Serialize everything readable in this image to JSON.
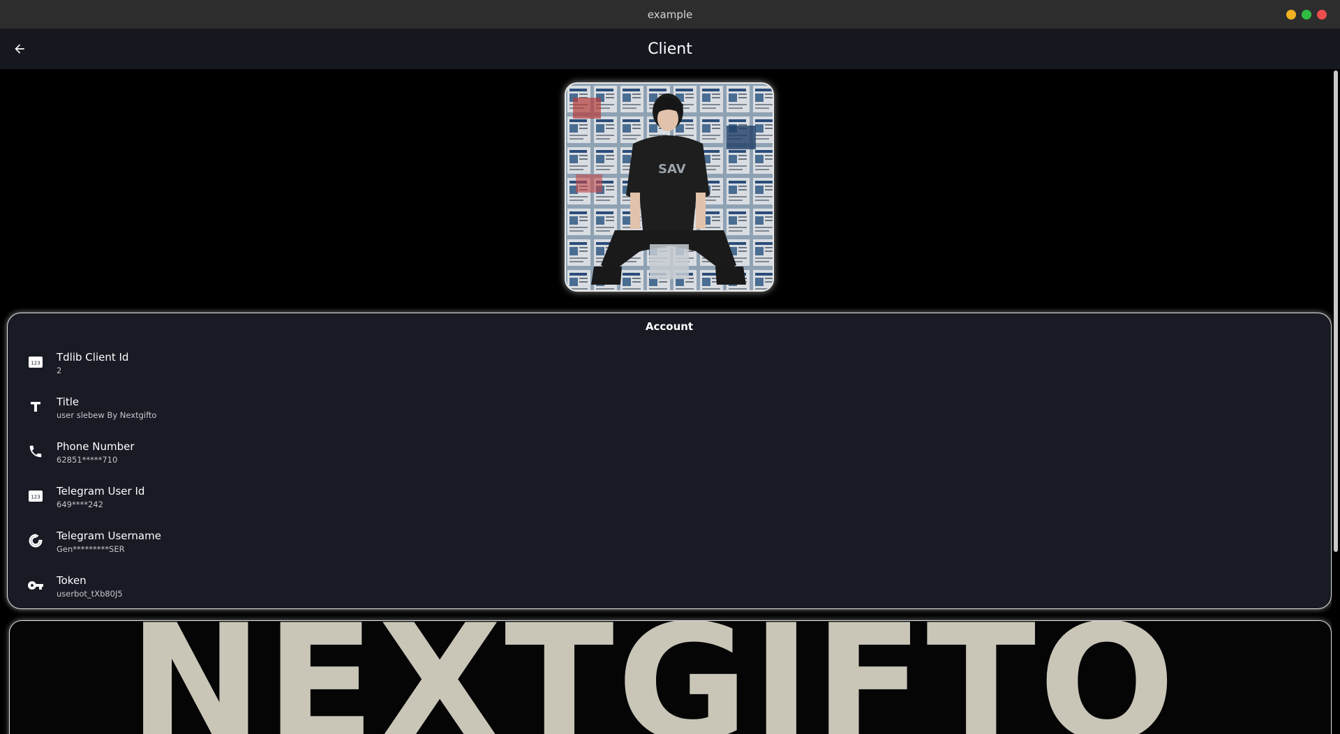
{
  "window": {
    "title": "example",
    "controls": [
      "minimize",
      "maximize",
      "close"
    ]
  },
  "appbar": {
    "title": "Client",
    "back_icon": "arrow-back-icon"
  },
  "profile": {
    "avatar_alt": "profile-photo"
  },
  "account": {
    "heading": "Account",
    "items": [
      {
        "icon": "number-icon",
        "label": "Tdlib Client Id",
        "value": "2"
      },
      {
        "icon": "text-title-icon",
        "label": "Title",
        "value": "user slebew By Nextgifto"
      },
      {
        "icon": "phone-icon",
        "label": "Phone Number",
        "value": "62851*****710"
      },
      {
        "icon": "number-icon",
        "label": "Telegram User Id",
        "value": "649****242"
      },
      {
        "icon": "circle-refresh-icon",
        "label": "Telegram Username",
        "value": "Gen*********SER"
      },
      {
        "icon": "key-icon",
        "label": "Token",
        "value": "userbot_tXb80J5"
      }
    ]
  },
  "banner": {
    "text": "NEXTGIFTO"
  },
  "colors": {
    "background": "#000000",
    "surface": "#181a24",
    "appbar": "#161820",
    "titlebar": "#2d2d2d",
    "border": "#e4e4e4",
    "banner_text": "#c9c6b8"
  }
}
